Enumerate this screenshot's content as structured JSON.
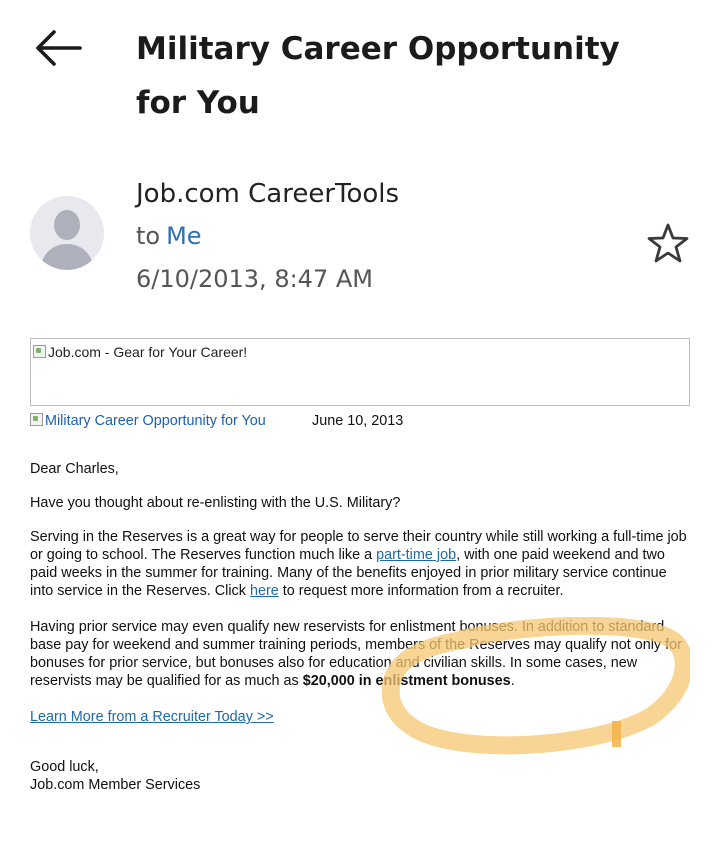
{
  "header": {
    "subject": "Military Career Opportunity for You"
  },
  "sender": {
    "name": "Job.com CareerTools",
    "to_prefix": "to",
    "to_recipient": "Me",
    "datetime": "6/10/2013, 8:47 AM"
  },
  "email_body": {
    "header_image_alt": "Job.com - Gear for Your Career!",
    "title_image_alt": "Military Career Opportunity for You",
    "title_date": "June 10, 2013",
    "greeting": "Dear Charles,",
    "question": "Have you thought about re-enlisting with the U.S. Military?",
    "para1_a": "Serving in the Reserves is a great way for people to serve their country while still working a full-time job or going to school. The Reserves function much like a ",
    "para1_link1": "part-time job",
    "para1_b": ", with one paid weekend and two paid weeks in the summer for training. Many of the benefits enjoyed in prior military service continue into service in the Reserves. Click ",
    "para1_link2": "here",
    "para1_c": " to request more information from a recruiter.",
    "para2_a": "Having prior service may even qualify new reservists for enlistment bonuses. In addition to standard base pay for weekend and summer training periods, members of the Reserves may qualify not only for bonuses for prior service, but bonuses also for education and civilian skills. In some cases, new reservists may be qualified for as much as ",
    "para2_bold": "$20,000 in enlistment bonuses",
    "para2_end": ".",
    "learn_more_link": "Learn More from a Recruiter Today >>",
    "signoff_line1": "Good luck,",
    "signoff_line2": "Job.com Member Services"
  },
  "icons": {
    "back": "back-arrow-icon",
    "star": "star-outline-icon",
    "avatar": "default-avatar-icon"
  },
  "colors": {
    "link_blue": "#2f6fb8",
    "highlight": "#f6c770"
  }
}
